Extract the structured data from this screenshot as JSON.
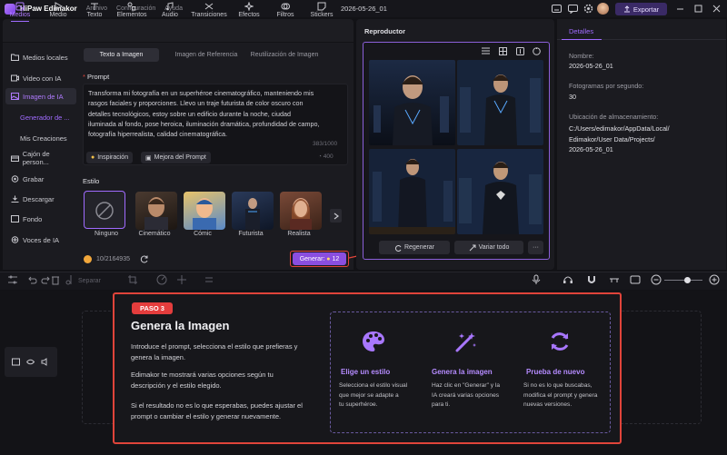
{
  "app": {
    "name": "HiPaw Edimakor",
    "menus": [
      "Archivo",
      "Configuración",
      "Ayuda"
    ],
    "project_date": "2026-05-26_01",
    "export_label": "Exportar"
  },
  "toolbar": {
    "tabs": [
      "Medios",
      "Medio",
      "Texto",
      "Elementos",
      "Audio",
      "Transiciones",
      "Efectos",
      "Filtros",
      "Stickers"
    ]
  },
  "sidebar": {
    "items": [
      {
        "label": "Medios locales"
      },
      {
        "label": "Video con IA"
      },
      {
        "label": "Imagen de IA"
      },
      {
        "label": "Cajón de person..."
      },
      {
        "label": "Grabar"
      },
      {
        "label": "Descargar"
      },
      {
        "label": "Fondo"
      },
      {
        "label": "Voces de IA"
      }
    ],
    "sub": [
      {
        "label": "Generador de ..."
      },
      {
        "label": "Mis Creaciones"
      }
    ]
  },
  "center": {
    "tabs": [
      "Texto a Imagen",
      "Imagen de Referencia",
      "Reutilización de Imagen"
    ],
    "prompt_label": "Prompt",
    "prompt_lines": [
      "Transforma mi fotografía en un superhéroe cinematográfico, manteniendo mis",
      "rasgos faciales y proporciones. Llevo un traje futurista de color oscuro con",
      "detalles tecnológicos, estoy sobre un edificio durante la noche, ciudad",
      "iluminada al fondo, pose heroica, iluminación dramática, profundidad de campo,",
      "fotografía hiperrealista, calidad cinematográfica."
    ],
    "char_count": "383/1000",
    "inspiration": "Inspiración",
    "improve": "Mejora del Prompt",
    "improve_count": "400",
    "style_label": "Estilo",
    "styles": [
      "Ninguno",
      "Cinemático",
      "Cómic",
      "Futurista",
      "Realista"
    ],
    "credits": "10/2164935",
    "generate_label": "Generar:",
    "generate_cost": "12"
  },
  "player": {
    "title": "Reproductor",
    "regenerate": "Regenerar",
    "vary_all": "Variar todo"
  },
  "details": {
    "tab": "Detalles",
    "name_label": "Nombre:",
    "name_value": "2026-05-26_01",
    "fps_label": "Fotogramas por segundo:",
    "fps_value": "30",
    "location_label": "Ubicación de almacenamiento:",
    "location_lines": [
      "C:/Users/edimakor/AppData/Local/",
      "Edimakor/User Data/Projects/",
      "2026-05-26_01"
    ]
  },
  "timeline": {
    "separate_label": "Separar"
  },
  "tutorial": {
    "step": "PASO 3",
    "title": "Genera la Imagen",
    "p1": [
      "Introduce el prompt, selecciona el estilo que prefieras y",
      "genera la imagen."
    ],
    "p2": [
      "Edimakor te mostrará varias opciones según tu",
      "descripción y el estilo elegido."
    ],
    "p3": [
      "Si el resultado no es lo que esperabas, puedes ajustar el",
      "prompt o cambiar el estilo y generar nuevamente."
    ],
    "cards": [
      {
        "title": "Elige un estilo",
        "icon": "palette-icon",
        "desc": [
          "Selecciona el estilo visual",
          "que mejor se adapte a",
          "tu superhéroe."
        ]
      },
      {
        "title": "Genera la imagen",
        "icon": "magic-wand-icon",
        "desc": [
          "Haz clic en \"Generar\" y la",
          "IA creará varias opciones",
          "para ti."
        ]
      },
      {
        "title": "Prueba de nuevo",
        "icon": "refresh-icon",
        "desc": [
          "Si no es lo que buscabas,",
          "modifica el prompt y genera",
          "nuevas versiones."
        ]
      }
    ]
  },
  "colors": {
    "accent": "#a06bff",
    "highlight": "#e0443a",
    "bg": "#121216"
  }
}
